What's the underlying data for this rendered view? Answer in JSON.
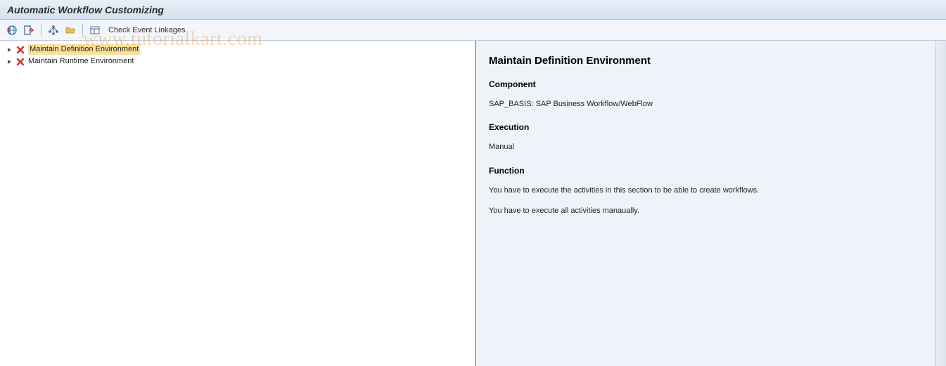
{
  "header": {
    "title": "Automatic Workflow Customizing"
  },
  "toolbar": {
    "back_icon": "back",
    "exit_icon": "exit",
    "tree_icon": "tree",
    "folder_icon": "folder",
    "layout_icon": "layout",
    "check_event_linkages": "Check Event Linkages"
  },
  "tree": {
    "items": [
      {
        "label": "Maintain Definition Environment",
        "selected": true,
        "status": "error"
      },
      {
        "label": "Maintain Runtime Environment",
        "selected": false,
        "status": "error"
      }
    ]
  },
  "detail": {
    "title": "Maintain Definition Environment",
    "component_heading": "Component",
    "component_text": "SAP_BASIS: SAP Business Workflow/WebFlow",
    "execution_heading": "Execution",
    "execution_text": "Manual",
    "function_heading": "Function",
    "function_text_1": "You have to execute the activities in this section to be able to create workflows.",
    "function_text_2": "You have to execute all activities manaually."
  },
  "watermark": "www.tutorialkart.com"
}
